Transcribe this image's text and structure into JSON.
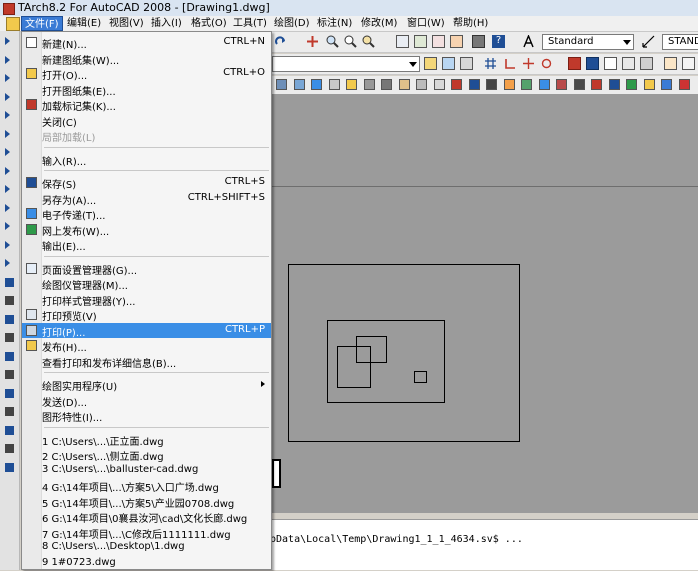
{
  "window": {
    "title": "TArch8.2 For AutoCAD 2008 - [Drawing1.dwg]"
  },
  "menubar": [
    {
      "label": "文件(F)",
      "open": true
    },
    {
      "label": "编辑(E)"
    },
    {
      "label": "视图(V)"
    },
    {
      "label": "插入(I)"
    },
    {
      "label": "格式(O)"
    },
    {
      "label": "工具(T)"
    },
    {
      "label": "绘图(D)"
    },
    {
      "label": "标注(N)"
    },
    {
      "label": "修改(M)"
    },
    {
      "label": "窗口(W)"
    },
    {
      "label": "帮助(H)"
    }
  ],
  "toolbar": {
    "text_style": "Standard",
    "dim_style": "STANDA"
  },
  "file_menu": {
    "groups": [
      [
        {
          "label": "新建(N)...",
          "shortcut": "CTRL+N",
          "icon": "new-file-icon"
        },
        {
          "label": "新建图纸集(W)...",
          "shortcut": ""
        },
        {
          "label": "打开(O)...",
          "shortcut": "CTRL+O",
          "icon": "open-folder-icon"
        },
        {
          "label": "打开图纸集(E)...",
          "shortcut": ""
        },
        {
          "label": "加载标记集(K)...",
          "shortcut": "",
          "icon": "markup-set-icon"
        },
        {
          "label": "关闭(C)",
          "shortcut": ""
        },
        {
          "label": "局部加载(L)",
          "shortcut": "",
          "disabled": true
        }
      ],
      [
        {
          "label": "输入(R)...",
          "shortcut": ""
        }
      ],
      [
        {
          "label": "保存(S)",
          "shortcut": "CTRL+S",
          "icon": "save-disk-icon"
        },
        {
          "label": "另存为(A)...",
          "shortcut": "CTRL+SHIFT+S"
        },
        {
          "label": "电子传递(T)...",
          "shortcut": "",
          "icon": "etransmit-icon"
        },
        {
          "label": "网上发布(W)...",
          "shortcut": "",
          "icon": "web-publish-icon"
        },
        {
          "label": "输出(E)...",
          "shortcut": ""
        }
      ],
      [
        {
          "label": "页面设置管理器(G)...",
          "shortcut": "",
          "icon": "page-setup-icon"
        },
        {
          "label": "绘图仪管理器(M)...",
          "shortcut": ""
        },
        {
          "label": "打印样式管理器(Y)...",
          "shortcut": ""
        },
        {
          "label": "打印预览(V)",
          "shortcut": "",
          "icon": "print-preview-icon"
        },
        {
          "label": "打印(P)...",
          "shortcut": "CTRL+P",
          "icon": "print-icon",
          "highlighted": true
        },
        {
          "label": "发布(H)...",
          "shortcut": "",
          "icon": "publish-icon"
        },
        {
          "label": "查看打印和发布详细信息(B)...",
          "shortcut": ""
        }
      ],
      [
        {
          "label": "绘图实用程序(U)",
          "shortcut": "",
          "submenu": true
        },
        {
          "label": "发送(D)...",
          "shortcut": ""
        },
        {
          "label": "图形特性(I)...",
          "shortcut": ""
        }
      ],
      [
        {
          "label": "1 C:\\Users\\...\\正立面.dwg",
          "shortcut": ""
        },
        {
          "label": "2 C:\\Users\\...\\侧立面.dwg",
          "shortcut": ""
        },
        {
          "label": "3 C:\\Users\\...\\balluster-cad.dwg",
          "shortcut": ""
        },
        {
          "label": "4 G:\\14年项目\\...\\方案5\\入口广场.dwg",
          "shortcut": ""
        },
        {
          "label": "5 G:\\14年项目\\...\\方案5\\产业园0708.dwg",
          "shortcut": ""
        },
        {
          "label": "6 G:\\14年项目\\0襄县汝河\\cad\\文化长廊.dwg",
          "shortcut": ""
        },
        {
          "label": "7 G:\\14年项目\\...\\C修改后1111111.dwg",
          "shortcut": ""
        },
        {
          "label": "8 C:\\Users\\...\\Desktop\\1.dwg",
          "shortcut": ""
        },
        {
          "label": "9 1#0723.dwg",
          "shortcut": ""
        }
      ]
    ]
  },
  "command_line": {
    "text": "pData\\Local\\Temp\\Drawing1_1_1_4634.sv$ ..."
  }
}
